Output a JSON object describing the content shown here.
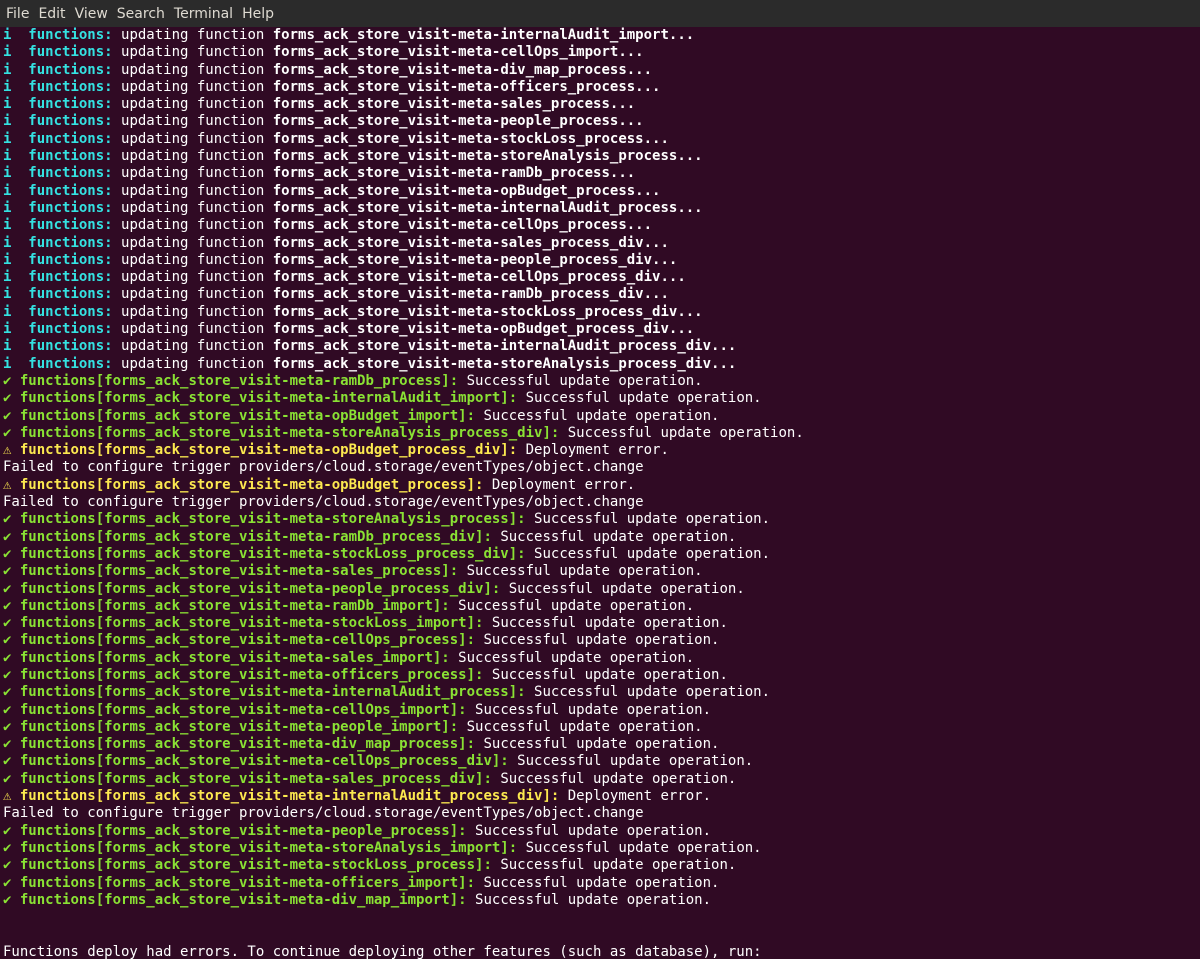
{
  "menu": [
    "File",
    "Edit",
    "View",
    "Search",
    "Terminal",
    "Help"
  ],
  "info_mark": "i",
  "ok_mark": "✔",
  "warn_mark": "⚠",
  "info_label": "functions:",
  "info_text": " updating function ",
  "info_lines": [
    "forms_ack_store_visit-meta-internalAudit_import...",
    "forms_ack_store_visit-meta-cellOps_import...",
    "forms_ack_store_visit-meta-div_map_process...",
    "forms_ack_store_visit-meta-officers_process...",
    "forms_ack_store_visit-meta-sales_process...",
    "forms_ack_store_visit-meta-people_process...",
    "forms_ack_store_visit-meta-stockLoss_process...",
    "forms_ack_store_visit-meta-storeAnalysis_process...",
    "forms_ack_store_visit-meta-ramDb_process...",
    "forms_ack_store_visit-meta-opBudget_process...",
    "forms_ack_store_visit-meta-internalAudit_process...",
    "forms_ack_store_visit-meta-cellOps_process...",
    "forms_ack_store_visit-meta-sales_process_div...",
    "forms_ack_store_visit-meta-people_process_div...",
    "forms_ack_store_visit-meta-cellOps_process_div...",
    "forms_ack_store_visit-meta-ramDb_process_div...",
    "forms_ack_store_visit-meta-stockLoss_process_div...",
    "forms_ack_store_visit-meta-opBudget_process_div...",
    "forms_ack_store_visit-meta-internalAudit_process_div...",
    "forms_ack_store_visit-meta-storeAnalysis_process_div..."
  ],
  "result_lines": [
    {
      "status": "ok",
      "label": "functions[forms_ack_store_visit-meta-ramDb_process]:",
      "message": " Successful update operation."
    },
    {
      "status": "ok",
      "label": "functions[forms_ack_store_visit-meta-internalAudit_import]:",
      "message": " Successful update operation."
    },
    {
      "status": "ok",
      "label": "functions[forms_ack_store_visit-meta-opBudget_import]:",
      "message": " Successful update operation."
    },
    {
      "status": "ok",
      "label": "functions[forms_ack_store_visit-meta-storeAnalysis_process_div]:",
      "message": " Successful update operation."
    },
    {
      "status": "warn",
      "label": "functions[forms_ack_store_visit-meta-opBudget_process_div]:",
      "message": " Deployment error."
    },
    {
      "status": "plain",
      "label": "",
      "message": "Failed to configure trigger providers/cloud.storage/eventTypes/object.change"
    },
    {
      "status": "warn",
      "label": "functions[forms_ack_store_visit-meta-opBudget_process]:",
      "message": " Deployment error."
    },
    {
      "status": "plain",
      "label": "",
      "message": "Failed to configure trigger providers/cloud.storage/eventTypes/object.change"
    },
    {
      "status": "ok",
      "label": "functions[forms_ack_store_visit-meta-storeAnalysis_process]:",
      "message": " Successful update operation."
    },
    {
      "status": "ok",
      "label": "functions[forms_ack_store_visit-meta-ramDb_process_div]:",
      "message": " Successful update operation."
    },
    {
      "status": "ok",
      "label": "functions[forms_ack_store_visit-meta-stockLoss_process_div]:",
      "message": " Successful update operation."
    },
    {
      "status": "ok",
      "label": "functions[forms_ack_store_visit-meta-sales_process]:",
      "message": " Successful update operation."
    },
    {
      "status": "ok",
      "label": "functions[forms_ack_store_visit-meta-people_process_div]:",
      "message": " Successful update operation."
    },
    {
      "status": "ok",
      "label": "functions[forms_ack_store_visit-meta-ramDb_import]:",
      "message": " Successful update operation."
    },
    {
      "status": "ok",
      "label": "functions[forms_ack_store_visit-meta-stockLoss_import]:",
      "message": " Successful update operation."
    },
    {
      "status": "ok",
      "label": "functions[forms_ack_store_visit-meta-cellOps_process]:",
      "message": " Successful update operation."
    },
    {
      "status": "ok",
      "label": "functions[forms_ack_store_visit-meta-sales_import]:",
      "message": " Successful update operation."
    },
    {
      "status": "ok",
      "label": "functions[forms_ack_store_visit-meta-officers_process]:",
      "message": " Successful update operation."
    },
    {
      "status": "ok",
      "label": "functions[forms_ack_store_visit-meta-internalAudit_process]:",
      "message": " Successful update operation."
    },
    {
      "status": "ok",
      "label": "functions[forms_ack_store_visit-meta-cellOps_import]:",
      "message": " Successful update operation."
    },
    {
      "status": "ok",
      "label": "functions[forms_ack_store_visit-meta-people_import]:",
      "message": " Successful update operation."
    },
    {
      "status": "ok",
      "label": "functions[forms_ack_store_visit-meta-div_map_process]:",
      "message": " Successful update operation."
    },
    {
      "status": "ok",
      "label": "functions[forms_ack_store_visit-meta-cellOps_process_div]:",
      "message": " Successful update operation."
    },
    {
      "status": "ok",
      "label": "functions[forms_ack_store_visit-meta-sales_process_div]:",
      "message": " Successful update operation."
    },
    {
      "status": "warn",
      "label": "functions[forms_ack_store_visit-meta-internalAudit_process_div]:",
      "message": " Deployment error."
    },
    {
      "status": "plain",
      "label": "",
      "message": "Failed to configure trigger providers/cloud.storage/eventTypes/object.change"
    },
    {
      "status": "ok",
      "label": "functions[forms_ack_store_visit-meta-people_process]:",
      "message": " Successful update operation."
    },
    {
      "status": "ok",
      "label": "functions[forms_ack_store_visit-meta-storeAnalysis_import]:",
      "message": " Successful update operation."
    },
    {
      "status": "ok",
      "label": "functions[forms_ack_store_visit-meta-stockLoss_process]:",
      "message": " Successful update operation."
    },
    {
      "status": "ok",
      "label": "functions[forms_ack_store_visit-meta-officers_import]:",
      "message": " Successful update operation."
    },
    {
      "status": "ok",
      "label": "functions[forms_ack_store_visit-meta-div_map_import]:",
      "message": " Successful update operation."
    }
  ],
  "footer_line": "Functions deploy had errors. To continue deploying other features (such as database), run:",
  "colors": {
    "background": "#300a24",
    "menubar": "#2b2b2b",
    "info": "#34e2e2",
    "ok": "#8ae234",
    "warn": "#fce94f",
    "text": "#ffffff"
  }
}
